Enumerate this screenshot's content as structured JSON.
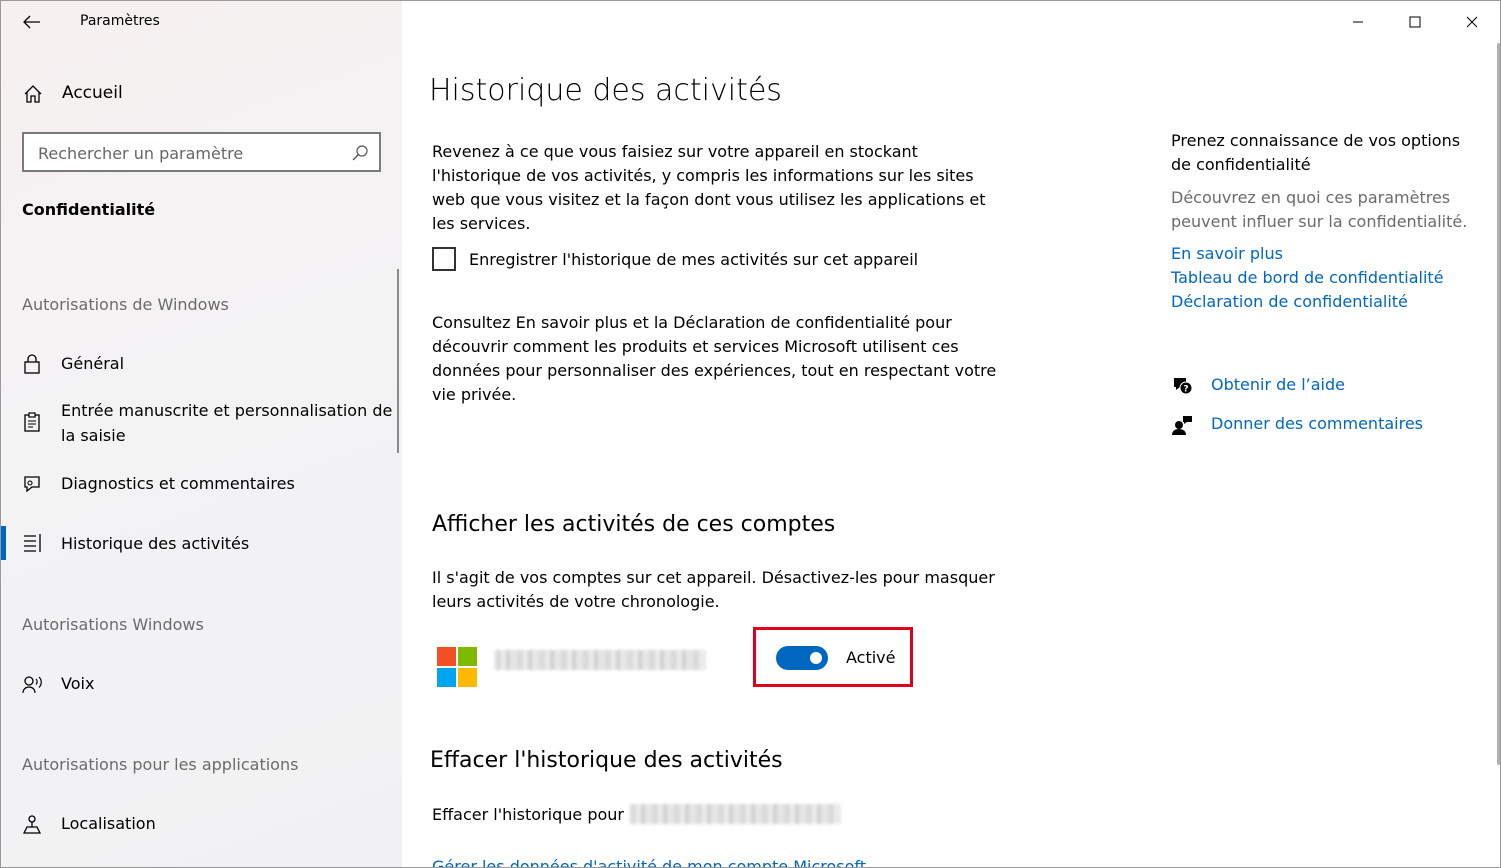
{
  "window": {
    "title": "Paramètres",
    "controls": {
      "minimize": "minimize",
      "maximize": "maximize",
      "close": "close"
    }
  },
  "sidebar": {
    "home_label": "Accueil",
    "search_placeholder": "Rechercher un paramètre",
    "category": "Confidentialité",
    "section_windows_permissions": "Autorisations de Windows",
    "section_windows_permissions_2": "Autorisations Windows",
    "section_app_permissions": "Autorisations pour les applications",
    "items": [
      {
        "label": "Général",
        "icon": "lock-icon"
      },
      {
        "label": "Entrée manuscrite et personnalisation de la saisie",
        "icon": "clipboard-icon"
      },
      {
        "label": "Diagnostics et commentaires",
        "icon": "feedback-icon"
      },
      {
        "label": "Historique des activités",
        "icon": "timeline-icon",
        "selected": true
      },
      {
        "label": "Voix",
        "icon": "voice-icon"
      },
      {
        "label": "Localisation",
        "icon": "location-icon"
      }
    ]
  },
  "main": {
    "title": "Historique des activités",
    "intro": "Revenez à ce que vous faisiez sur votre appareil en stockant l'historique de vos activités, y compris les informations sur les sites web que vous visitez et la façon dont vous utilisez les applications et les services.",
    "checkbox_label": "Enregistrer l'historique de mes activités sur cet appareil",
    "checkbox_checked": false,
    "privacy_text": "Consultez En savoir plus et la Déclaration de confidentialité pour découvrir comment les produits et services Microsoft utilisent ces données pour personnaliser des expériences, tout en respectant votre vie privée.",
    "accounts_title": "Afficher les activités de ces comptes",
    "accounts_desc": "Il s'agit de vos comptes sur cet appareil. Désactivez-les pour masquer leurs activités de votre chronologie.",
    "toggle_label": "Activé",
    "toggle_on": true,
    "clear_title": "Effacer l'historique des activités",
    "clear_for_label": "Effacer l'historique pour",
    "cut_link": "Gérer les données d'activité de mon compte Microsoft"
  },
  "aside": {
    "title": "Prenez connaissance de vos options de confidentialité",
    "desc": "Découvrez en quoi ces paramètres peuvent influer sur la confidentialité.",
    "links": [
      "En savoir plus",
      "Tableau de bord de confidentialité",
      "Déclaration de confidentialité"
    ],
    "help": "Obtenir de l’aide",
    "feedback": "Donner des commentaires"
  },
  "colors": {
    "accent": "#0067c0",
    "highlight": "#e0001b",
    "ms_red": "#f25022",
    "ms_green": "#7fba00",
    "ms_blue": "#00a4ef",
    "ms_yellow": "#ffb900"
  }
}
